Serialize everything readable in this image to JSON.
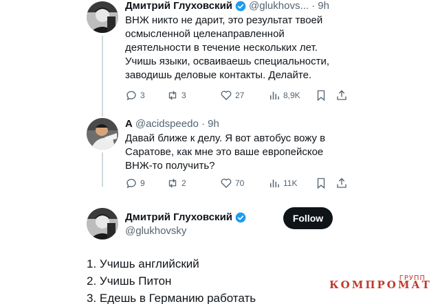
{
  "tweets": [
    {
      "name": "Дмитрий Глуховский",
      "handle": "@glukhovs... · 9h",
      "text_lines": [
        "ВНЖ никто не дарит, это результат твоей",
        "осмысленной целенаправленной",
        "деятельности в течение нескольких лет.",
        "Учишь языки, осваиваешь специальности,",
        "заводишь деловые контакты. Делайте."
      ],
      "replies": "3",
      "reposts": "3",
      "likes": "27",
      "views": "8,9K"
    },
    {
      "name": "A",
      "handle": "@acidspeedo · 9h",
      "text_lines": [
        "Давай ближе к делу. Я вот автобус вожу в",
        "Саратове, как мне это ваше европейское",
        "ВНЖ-то получить?"
      ],
      "replies": "9",
      "reposts": "2",
      "likes": "70",
      "views": "11K"
    }
  ],
  "main_tweet": {
    "name": "Дмитрий Глуховский",
    "handle": "@glukhovsky",
    "follow_label": "Follow",
    "lines": [
      "1. Учишь английский",
      "2. Учишь Питон",
      "3. Едешь в Германию работать"
    ]
  },
  "watermark": {
    "top": "ГРУПП",
    "main": "КОМПРОМАТ"
  },
  "colors": {
    "text": "#0f1419",
    "secondary": "#536471",
    "verified": "#1d9bf0",
    "watermark": "#c0392b"
  }
}
